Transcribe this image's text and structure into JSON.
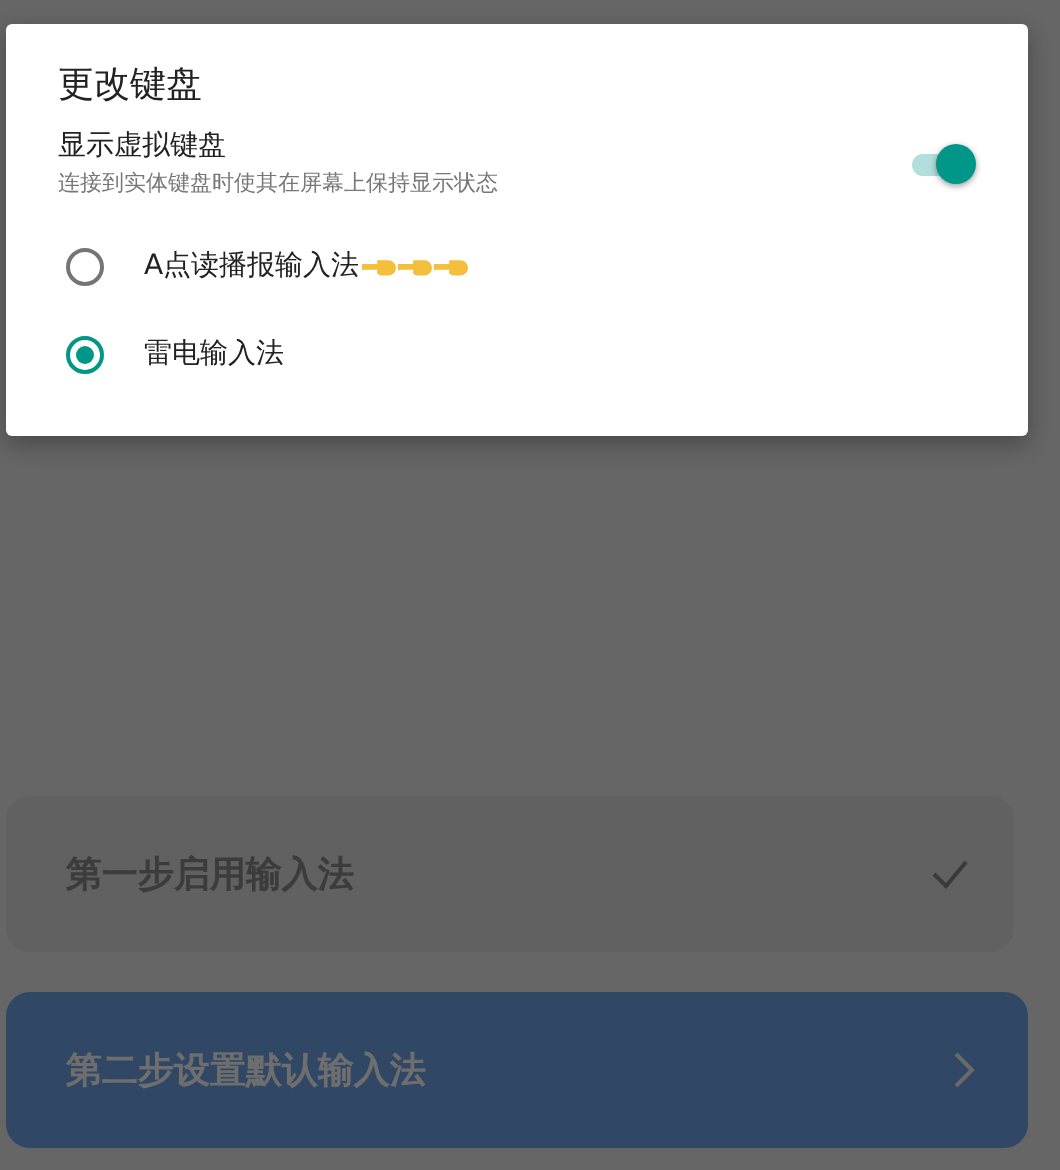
{
  "dialog": {
    "title": "更改键盘",
    "toggle": {
      "label": "显示虚拟键盘",
      "description": "连接到实体键盘时使其在屏幕上保持显示状态",
      "on": true
    },
    "options": [
      {
        "label": "A点读播报输入法",
        "selected": false,
        "icons": [
          {
            "kind": "pointing-hand"
          },
          {
            "kind": "pointing-hand"
          },
          {
            "kind": "pointing-hand"
          }
        ]
      },
      {
        "label": "雷电输入法",
        "selected": true
      }
    ]
  },
  "steps": [
    {
      "label": "第一步启用输入法",
      "kind": "done"
    },
    {
      "label": "第二步设置默认输入法",
      "kind": "next"
    }
  ]
}
